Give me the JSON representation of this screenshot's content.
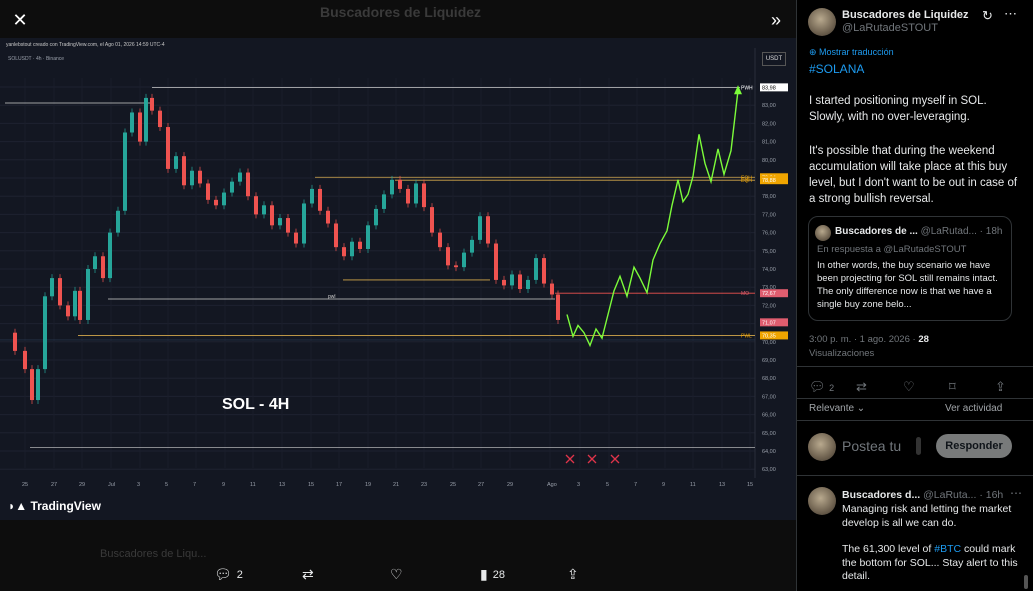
{
  "viewer": {
    "background_title": "Buscadores de Liquidez",
    "close_icon": "close-icon",
    "expand_icon": "double-chevron-right-icon",
    "background_row_text": "Buscadores de Liqu...",
    "actions": {
      "replies": "2",
      "reposts": "",
      "likes": "",
      "views": "28"
    }
  },
  "chart": {
    "header": "yanlebstout creado con TradingView.com, el Ago 01, 2026 14:59 UTC-4",
    "symbol": "SOLUSDT · 4h · Binance",
    "currency": "USDT",
    "annotation": "SOL - 4H",
    "logo_text": "TradingView",
    "pwl_mid_label": "pwl",
    "price_labels": [
      {
        "price": 83.98,
        "text": "83,98",
        "tag": "PWH",
        "color": "#ffffff"
      },
      {
        "price": 79.04,
        "text": "79,04",
        "tag": "EQH",
        "color": "#f0a500"
      },
      {
        "price": 78.88,
        "text": "78,88",
        "tag": "EQH",
        "color": "#f0a500"
      },
      {
        "price": 72.67,
        "text": "72,67",
        "tag": "MO",
        "color": "#e05d6f"
      },
      {
        "price": 71.07,
        "text": "71,07",
        "tag": "",
        "color": "#e05d6f"
      },
      {
        "price": 70.35,
        "text": "70,35",
        "tag": "PWL",
        "color": "#f0a500"
      }
    ],
    "y_ticks": [
      "84,00",
      "83,00",
      "82,00",
      "81,00",
      "80,00",
      "79,00",
      "78,00",
      "77,00",
      "76,00",
      "75,00",
      "74,00",
      "73,00",
      "72,00",
      "71,00",
      "70,00",
      "69,00",
      "68,00",
      "67,00",
      "66,00",
      "65,00",
      "64,00",
      "63,00"
    ],
    "x_ticks": [
      "25",
      "27",
      "29",
      "Jul",
      "3",
      "5",
      "7",
      "9",
      "11",
      "13",
      "15",
      "17",
      "19",
      "21",
      "23",
      "25",
      "27",
      "29",
      "Ago",
      "3",
      "5",
      "7",
      "9",
      "11",
      "13",
      "15"
    ],
    "colors": {
      "up": "#26a69a",
      "down": "#ef5350",
      "projection": "#7cfc3a",
      "level": "#d4a84b"
    }
  },
  "side": {
    "account_name": "Buscadores de Liquidez",
    "handle": "@LaRutadeSTOUT",
    "translate_label": "Mostrar traducción",
    "hashtag": "#SOLANA",
    "body_p1": "I started positioning myself in SOL. Slowly, with no over-leveraging.",
    "body_p2": "It's possible that during the weekend accumulation will take place at this buy level, but I don't want to be out in case of a strong bullish reversal.",
    "quote": {
      "name": "Buscadores de ...",
      "handle": "@LaRutad...",
      "time": "· 18h",
      "reply_to": "En respuesta a @LaRutadeSTOUT",
      "text": "In other words, the buy scenario we have been projecting for SOL still remains intact. The only difference now is that we have a single buy zone belo..."
    },
    "timestamp": "3:00 p. m. · 1 ago. 2026 ·",
    "views_count": "28",
    "views_label": "Visualizaciones",
    "reply_count": "2",
    "relevant_label": "Relevante",
    "activity_label": "Ver actividad",
    "compose_placeholder": "Postea tu",
    "reply_button": "Responder",
    "reply_tweet": {
      "name": "Buscadores d...",
      "handle": "@LaRuta...",
      "time": "· 16h",
      "p1": "Managing risk and letting the market develop is all we can do.",
      "p2_pre": "The 61,300 level of ",
      "p2_tag": "#BTC",
      "p2_post": " could mark the bottom for SOL... Stay alert to this detail."
    }
  }
}
